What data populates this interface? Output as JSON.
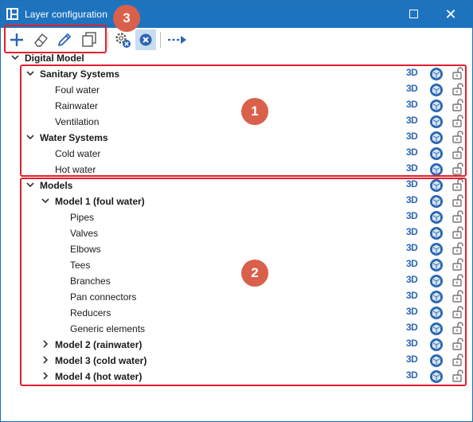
{
  "window": {
    "title": "Layer configuration",
    "maximize_icon": "maximize-icon",
    "close_icon": "close-icon"
  },
  "toolbar": {
    "buttons": [
      {
        "name": "add-layer-button",
        "icon": "plus-icon"
      },
      {
        "name": "eraser-button",
        "icon": "eraser-icon"
      },
      {
        "name": "edit-button",
        "icon": "pencil-icon"
      },
      {
        "name": "copy-button",
        "icon": "copy-icon"
      },
      {
        "name": "settings-button",
        "icon": "gear-x-icon"
      },
      {
        "name": "cancel-button",
        "icon": "x-circle-icon"
      },
      {
        "name": "move-button",
        "icon": "dashed-arrow-icon"
      }
    ]
  },
  "tree": {
    "root": "Digital Model",
    "sanitary": {
      "label": "Sanitary Systems",
      "children": [
        "Foul water",
        "Rainwater",
        "Ventilation"
      ]
    },
    "water": {
      "label": "Water Systems",
      "children": [
        "Cold water",
        "Hot water"
      ]
    },
    "models": {
      "label": "Models",
      "model1": {
        "label": "Model 1 (foul water)",
        "children": [
          "Pipes",
          "Valves",
          "Elbows",
          "Tees",
          "Branches",
          "Pan connectors",
          "Reducers",
          "Generic elements"
        ]
      },
      "model2": "Model 2 (rainwater)",
      "model3": "Model 3 (cold water)",
      "model4": "Model 4 (hot water)"
    },
    "row_icons": {
      "view3d": "3D",
      "visibility": "cube-icon",
      "lock": "unlock-icon"
    }
  },
  "callouts": [
    "1",
    "2",
    "3"
  ],
  "colors": {
    "titlebar": "#1e73be",
    "callout": "#e01f2d",
    "badge": "#d9604a",
    "icon_blue": "#2b66b3"
  }
}
